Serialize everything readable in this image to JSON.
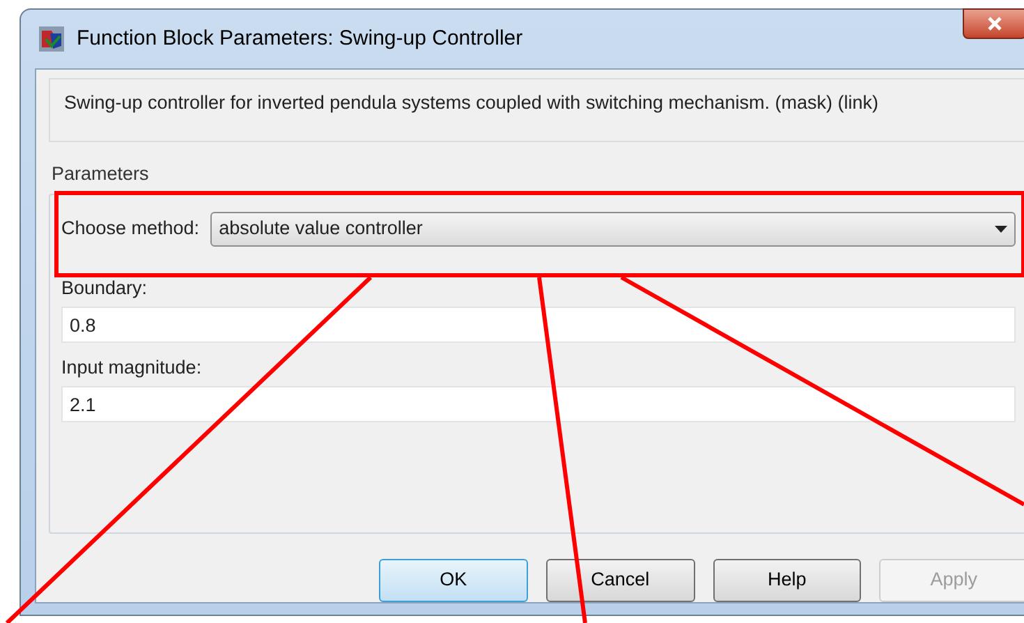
{
  "window": {
    "title": "Function Block Parameters: Swing-up Controller"
  },
  "description": "Swing-up controller for inverted pendula systems coupled with switching mechanism. (mask) (link)",
  "parameters": {
    "title": "Parameters",
    "method": {
      "label": "Choose method:",
      "value": "absolute value controller"
    },
    "fields": [
      {
        "label": "Boundary:",
        "value": "0.8"
      },
      {
        "label": "Input magnitude:",
        "value": "2.1"
      }
    ]
  },
  "buttons": [
    {
      "label": "OK",
      "default": true,
      "disabled": false
    },
    {
      "label": "Cancel",
      "default": false,
      "disabled": false
    },
    {
      "label": "Help",
      "default": false,
      "disabled": false
    },
    {
      "label": "Apply",
      "default": false,
      "disabled": true
    }
  ]
}
